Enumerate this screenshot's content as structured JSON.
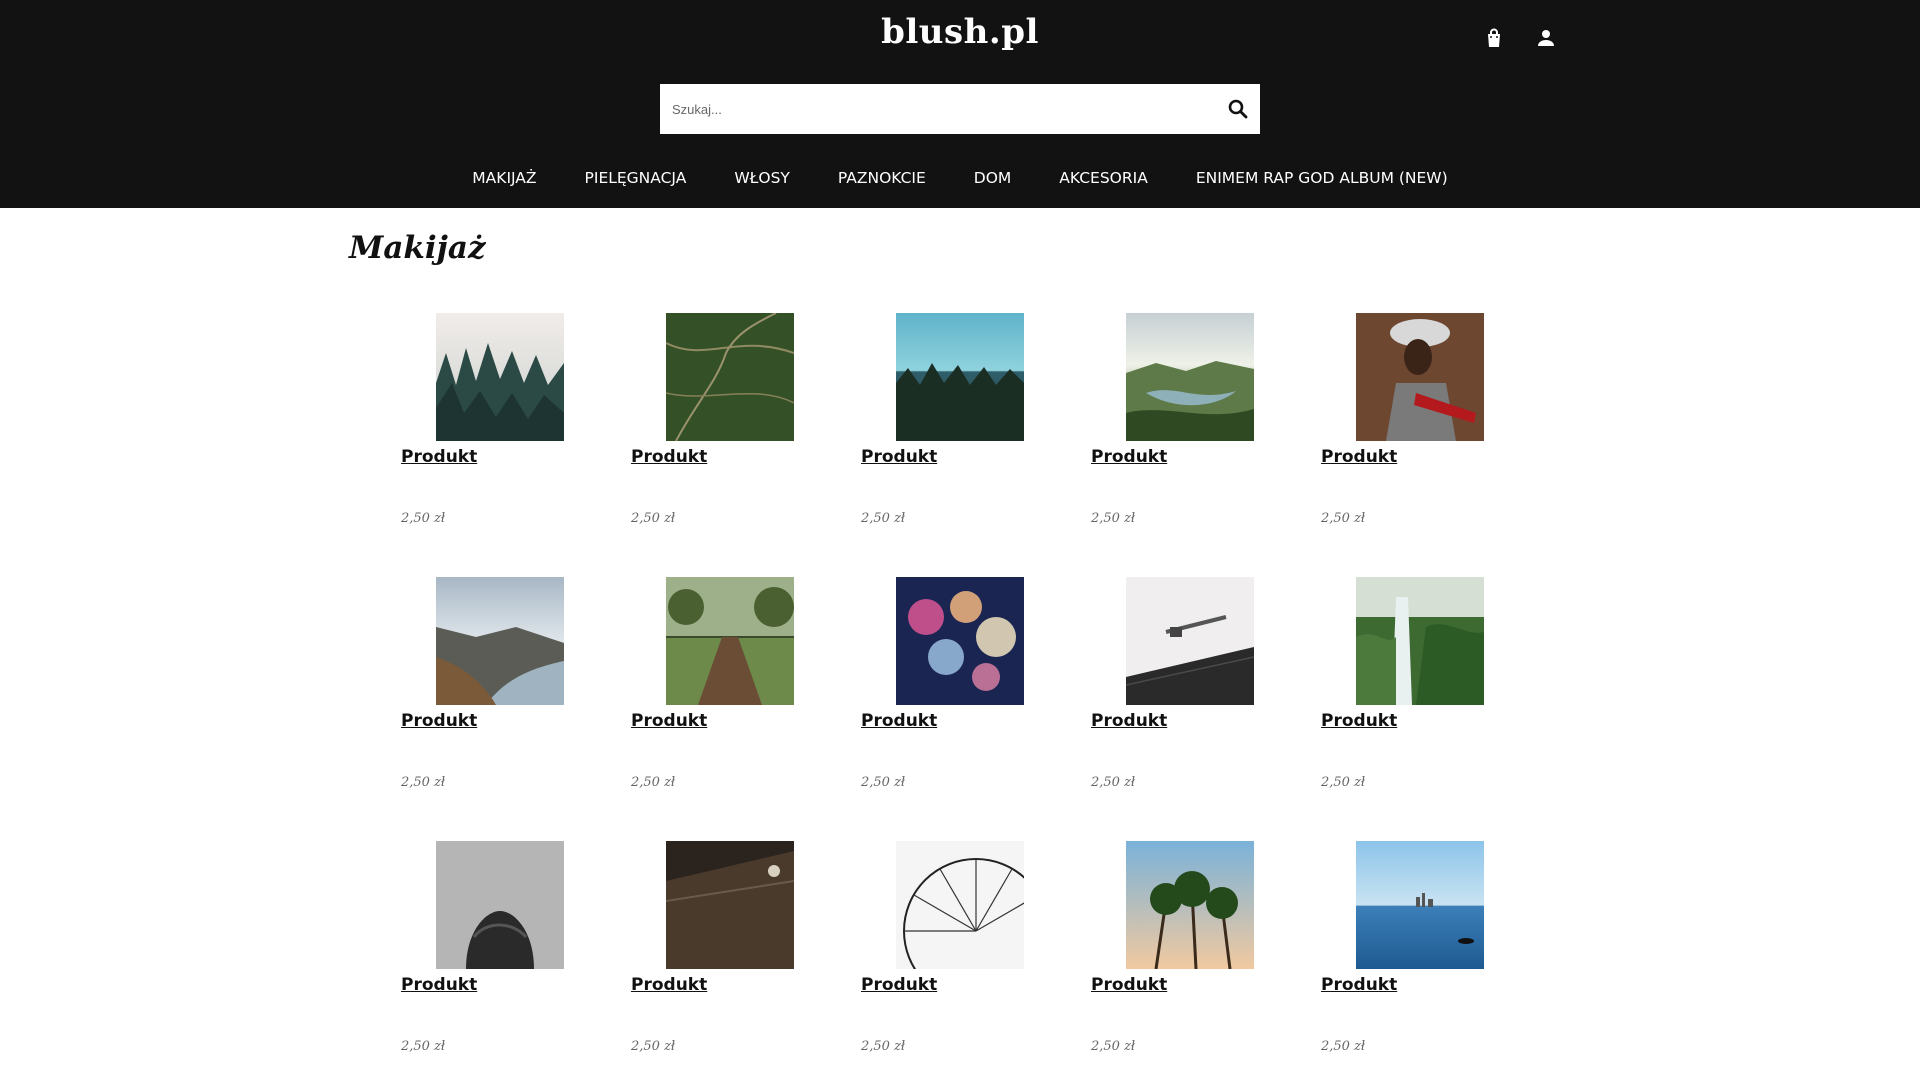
{
  "header": {
    "brand": "blush.pl",
    "icons": [
      "shopping-bag-icon",
      "user-icon",
      "search-icon"
    ],
    "search_placeholder": "Szukaj...",
    "nav": [
      "MAKIJAŻ",
      "PIELĘGNACJA",
      "WŁOSY",
      "PAZNOKCIE",
      "DOM",
      "AKCESORIA",
      "ENIMEM RAP GOD ALBUM (NEW)"
    ]
  },
  "main": {
    "title": "Makijaż",
    "products": [
      {
        "name": "Produkt",
        "price": "2,50 zł"
      },
      {
        "name": "Produkt",
        "price": "2,50 zł"
      },
      {
        "name": "Produkt",
        "price": "2,50 zł"
      },
      {
        "name": "Produkt",
        "price": "2,50 zł"
      },
      {
        "name": "Produkt",
        "price": "2,50 zł"
      },
      {
        "name": "Produkt",
        "price": "2,50 zł"
      },
      {
        "name": "Produkt",
        "price": "2,50 zł"
      },
      {
        "name": "Produkt",
        "price": "2,50 zł"
      },
      {
        "name": "Produkt",
        "price": "2,50 zł"
      },
      {
        "name": "Produkt",
        "price": "2,50 zł"
      },
      {
        "name": "Produkt",
        "price": "2,50 zł"
      },
      {
        "name": "Produkt",
        "price": "2,50 zł"
      },
      {
        "name": "Produkt",
        "price": "2,50 zł"
      },
      {
        "name": "Produkt",
        "price": "2,50 zł"
      },
      {
        "name": "Produkt",
        "price": "2,50 zł"
      }
    ]
  },
  "colors": {
    "header_bg": "#121212",
    "text": "#111111",
    "price": "#666666"
  }
}
